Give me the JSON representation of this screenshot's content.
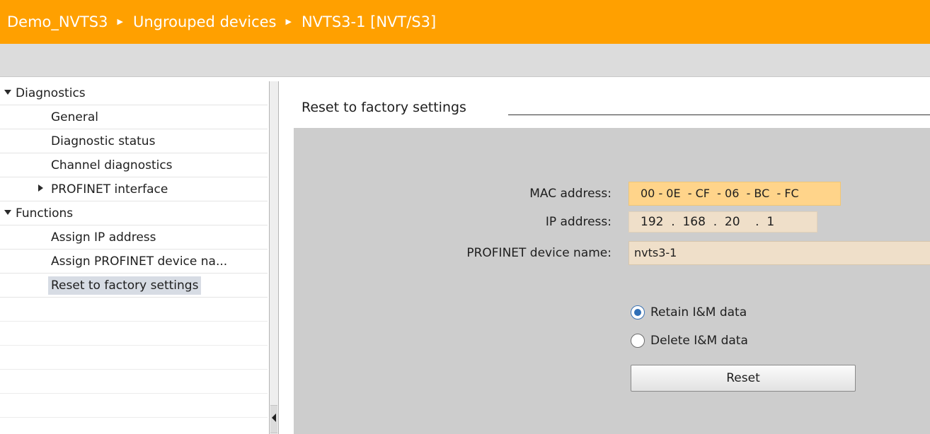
{
  "breadcrumb": {
    "items": [
      "Demo_NVTS3",
      "Ungrouped devices",
      "NVTS3-1 [NVT/S3]"
    ],
    "separator": "▶"
  },
  "nav": {
    "items": [
      {
        "label": "Diagnostics",
        "level": 0,
        "expander": "expanded"
      },
      {
        "label": "General",
        "level": 1
      },
      {
        "label": "Diagnostic status",
        "level": 1
      },
      {
        "label": "Channel diagnostics",
        "level": 1
      },
      {
        "label": "PROFINET interface",
        "level": 1,
        "expander": "collapsed"
      },
      {
        "label": "Functions",
        "level": 0,
        "expander": "expanded"
      },
      {
        "label": "Assign IP address",
        "level": 1
      },
      {
        "label": "Assign PROFINET device na...",
        "level": 1
      },
      {
        "label": "Reset to factory settings",
        "level": 1,
        "selected": true
      }
    ]
  },
  "panel": {
    "title": "Reset to factory settings",
    "mac_label": "MAC address:",
    "mac_value": "00 - 0E  - CF  - 06  - BC  - FC",
    "ip_label": "IP address:",
    "ip_value": "192  .  168  .  20    .  1",
    "name_label": "PROFINET device name:",
    "name_value": "nvts3-1",
    "options": [
      {
        "label": "Retain I&M data",
        "checked": true
      },
      {
        "label": "Delete I&M data",
        "checked": false
      }
    ],
    "reset_label": "Reset"
  },
  "colors": {
    "titlebar": "#ffa000",
    "accent_field": "#ffd48a",
    "readonly_field": "#efdfc9",
    "selection": "#d7dce4"
  }
}
